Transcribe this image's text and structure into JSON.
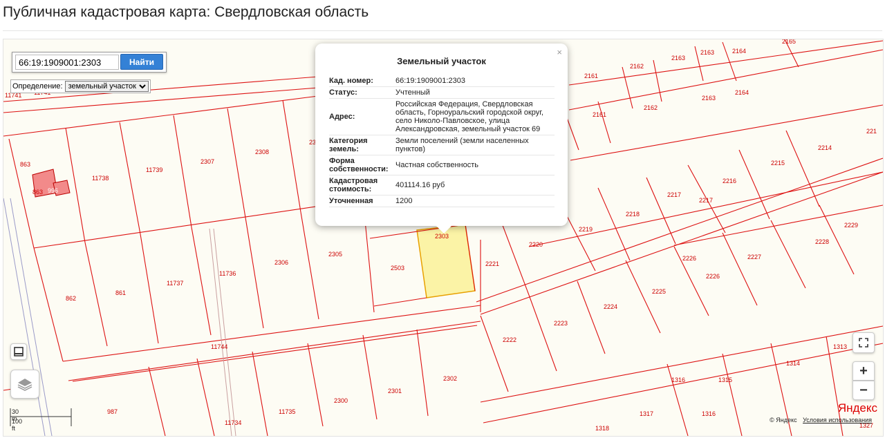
{
  "page": {
    "title": "Публичная кадастровая карта: Свердловская область"
  },
  "search": {
    "value": "66:19:1909001:2303",
    "button_label": "Найти"
  },
  "definition": {
    "label": "Определение:",
    "selected": "земельный участок"
  },
  "popup": {
    "title": "Земельный участок",
    "close_icon": "×",
    "rows": [
      {
        "key": "Кад. номер:",
        "value": "66:19:1909001:2303"
      },
      {
        "key": "Статус:",
        "value": "Учтенный"
      },
      {
        "key": "Адрес:",
        "value": "Российская Федерация, Свердловская область, Горноуральский городской округ, село Николо-Павловское, улица Александровская, земельный участок 69"
      },
      {
        "key": "Категория земель:",
        "value": "Земли поселений (земли населенных пунктов)"
      },
      {
        "key": "Форма собственности:",
        "value": "Частная собственность"
      },
      {
        "key": "Кадастровая стоимость:",
        "value": "401114.16 руб"
      },
      {
        "key": "Уточненная",
        "value": "1200"
      }
    ]
  },
  "map": {
    "labels": [
      "11741",
      "11741",
      "863",
      "863",
      "996",
      "11738",
      "11739",
      "2307",
      "2308",
      "23",
      "862",
      "861",
      "11737",
      "11736",
      "2306",
      "2305",
      "2503",
      "2303",
      "2221",
      "2220",
      "2219",
      "2218",
      "2217",
      "2217",
      "2216",
      "2215",
      "2214",
      "2161",
      "2161",
      "2162",
      "2162",
      "2163",
      "2163",
      "2163",
      "2164",
      "2164",
      "2165",
      "2229",
      "2228",
      "2227",
      "2226",
      "2226",
      "2225",
      "2224",
      "2223",
      "2222",
      "11744",
      "987",
      "11734",
      "11735",
      "2300",
      "2301",
      "2302",
      "1316",
      "1315",
      "1314",
      "1313",
      "1317",
      "1316",
      "1318",
      "1327",
      "221"
    ],
    "highlight_color": "#fbf3a6",
    "line_color": "#dd1111"
  },
  "controls": {
    "ruler_icon": "ruler-icon",
    "layers_icon": "layers-icon",
    "fullscreen_icon": "fullscreen-icon",
    "zoom_in": "+",
    "zoom_out": "−"
  },
  "scale": {
    "metric": "30 m",
    "imperial": "100 ft"
  },
  "attribution": {
    "logo": "Яндекс",
    "copyright": "© Яндекс",
    "terms": "Условия использования"
  }
}
